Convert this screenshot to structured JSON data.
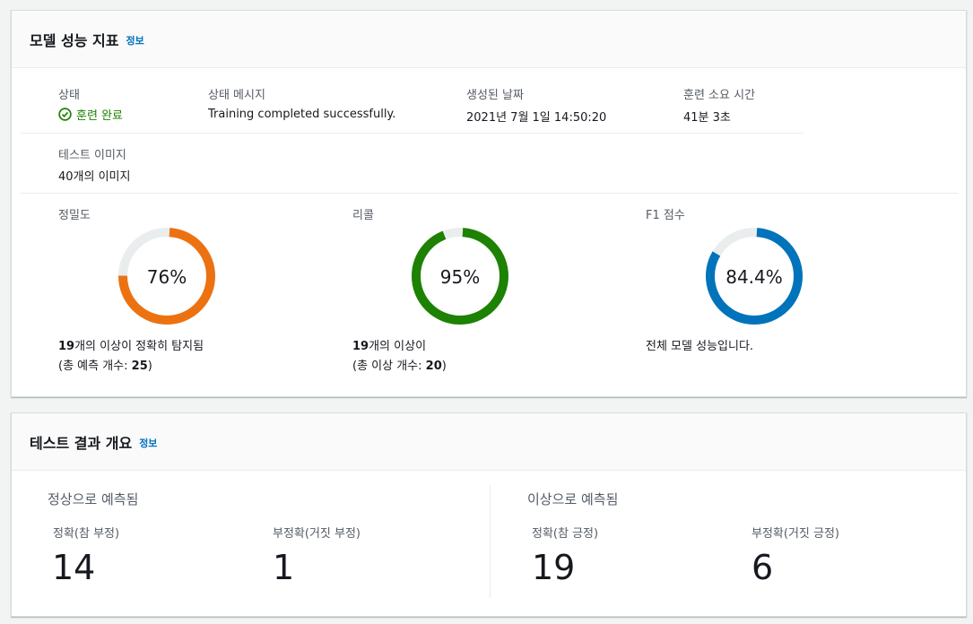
{
  "metrics_panel": {
    "title": "모델 성능 지표",
    "info": "정보",
    "status": {
      "label": "상태",
      "value": "훈련 완료"
    },
    "status_message": {
      "label": "상태 메시지",
      "value": "Training completed successfully."
    },
    "created": {
      "label": "생성된 날짜",
      "value": "2021년 7월 1일 14:50:20"
    },
    "duration": {
      "label": "훈련 소요 시간",
      "value": "41분 3초"
    },
    "test_images": {
      "label": "테스트 이미지",
      "value": "40개의 이미지"
    },
    "precision": {
      "label": "정밀도",
      "value": "76%",
      "fraction": 0.76,
      "color": "#ec7211",
      "count": "19",
      "desc1": "개의 이상이 정확히 탐지됨",
      "desc2_prefix": "(총 예측 개수: ",
      "total": "25",
      "desc2_suffix": ")"
    },
    "recall": {
      "label": "리콜",
      "value": "95%",
      "fraction": 0.95,
      "color": "#1d8102",
      "count": "19",
      "desc1": "개의 이상이",
      "desc2_prefix": "(총 이상 개수: ",
      "total": "20",
      "desc2_suffix": ")"
    },
    "f1": {
      "label": "F1 점수",
      "value": "84.4%",
      "fraction": 0.844,
      "color": "#0073bb",
      "desc1": "전체 모델 성능입니다."
    }
  },
  "results_panel": {
    "title": "테스트 결과 개요",
    "info": "정보",
    "normal": {
      "title": "정상으로 예측됨",
      "tn_label": "정확(참 부정)",
      "tn_value": "14",
      "fn_label": "부정확(거짓 부정)",
      "fn_value": "1"
    },
    "anomaly": {
      "title": "이상으로 예측됨",
      "tp_label": "정확(참 긍정)",
      "tp_value": "19",
      "fp_label": "부정확(거짓 긍정)",
      "fp_value": "6"
    }
  },
  "track_color": "#eaeded"
}
